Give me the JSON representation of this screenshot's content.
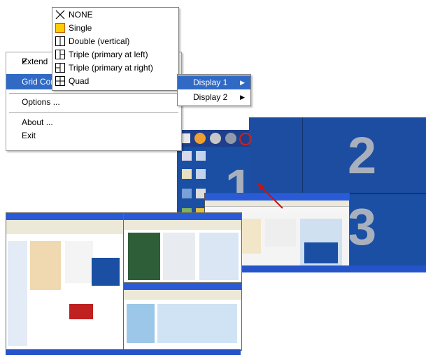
{
  "context_menu": {
    "items": [
      {
        "label": "Extend",
        "checked": true
      },
      {
        "label": "Grid Con",
        "highlighted": true
      },
      {
        "label": "Options ..."
      },
      {
        "label": "About ..."
      },
      {
        "label": "Exit"
      }
    ]
  },
  "grid_options": {
    "items": [
      {
        "label": "NONE",
        "icon": "none-x-icon"
      },
      {
        "label": "Single",
        "icon": "single-icon"
      },
      {
        "label": "Double (vertical)",
        "icon": "double-vertical-icon"
      },
      {
        "label": "Triple (primary at left)",
        "icon": "triple-left-icon"
      },
      {
        "label": "Triple (primary at right)",
        "icon": "triple-right-icon"
      },
      {
        "label": "Quad",
        "icon": "quad-icon"
      }
    ]
  },
  "display_submenu": {
    "items": [
      {
        "label": "Display 1",
        "arrow": "▶",
        "highlighted": true
      },
      {
        "label": "Display 2",
        "arrow": "▶"
      }
    ]
  },
  "grid_zones": [
    "1",
    "2",
    "3"
  ],
  "colors": {
    "highlight": "#316ac5",
    "desktop_blue": "#1a4fa3",
    "zone_number": "#a9b0bd",
    "pointer_arrow": "#d01010"
  }
}
